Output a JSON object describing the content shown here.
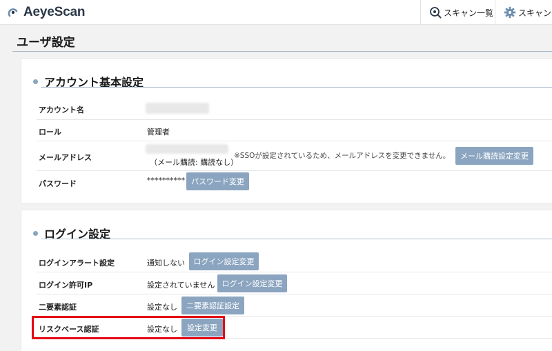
{
  "header": {
    "logo_text": "AeyeScan",
    "nav": [
      {
        "label": "スキャン一覧",
        "icon": "scan-list-icon"
      },
      {
        "label": "スキャンメ",
        "icon": "gear-icon"
      }
    ]
  },
  "page": {
    "title": "ユーザ設定"
  },
  "account": {
    "title": "アカウント基本設定",
    "rows": {
      "name": {
        "label": "アカウント名"
      },
      "role": {
        "label": "ロール",
        "value": "管理者"
      },
      "email": {
        "label": "メールアドレス",
        "subscription": "（メール購読: 購読なし）",
        "note": "※SSOが設定されているため、メールアドレスを変更できません。",
        "button": "メール購読設定変更"
      },
      "password": {
        "label": "パスワード",
        "value": "**********",
        "button": "パスワード変更"
      }
    }
  },
  "login": {
    "title": "ログイン設定",
    "rows": {
      "alert": {
        "label": "ログインアラート設定",
        "value": "通知しない",
        "button": "ログイン設定変更"
      },
      "ip": {
        "label": "ログイン許可IP",
        "value": "設定されていません",
        "button": "ログイン設定変更"
      },
      "twofa": {
        "label": "二要素認証",
        "value": "設定なし",
        "button": "二要素認証設定"
      },
      "risk": {
        "label": "リスクベース認証",
        "value": "設定なし",
        "button": "設定変更"
      }
    }
  },
  "colors": {
    "accent": "#8ba5c0",
    "highlight": "#e50012"
  }
}
